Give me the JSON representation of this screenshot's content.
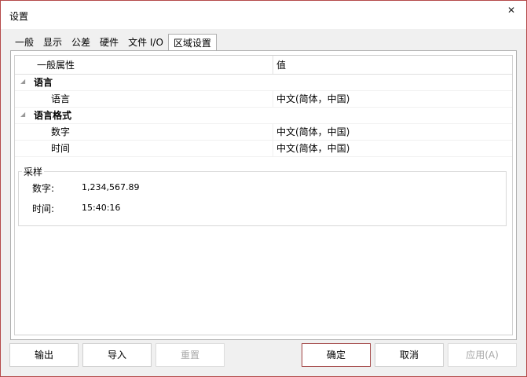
{
  "window": {
    "title": "设置"
  },
  "tabs": [
    {
      "label": "一般"
    },
    {
      "label": "显示"
    },
    {
      "label": "公差"
    },
    {
      "label": "硬件"
    },
    {
      "label": "文件 I/O"
    },
    {
      "label": "区域设置",
      "active": true
    }
  ],
  "grid": {
    "columns": [
      "一般属性",
      "值"
    ],
    "categories": [
      {
        "label": "语言",
        "items": [
          {
            "label": "语言",
            "value": "中文(简体，中国)"
          }
        ]
      },
      {
        "label": "语言格式",
        "items": [
          {
            "label": "数字",
            "value": "中文(简体，中国)"
          },
          {
            "label": "时间",
            "value": "中文(简体，中国)"
          }
        ]
      }
    ]
  },
  "sample": {
    "title": "采样",
    "number_label": "数字:",
    "number_value": "1,234,567.89",
    "time_label": "时间:",
    "time_value": "15:40:16"
  },
  "buttons": {
    "export": "输出",
    "import": "导入",
    "reset": "重置",
    "ok": "确定",
    "cancel": "取消",
    "apply": "应用(A)"
  },
  "colors": {
    "accent_border": "#a04040",
    "window_border": "#b54a4a"
  }
}
